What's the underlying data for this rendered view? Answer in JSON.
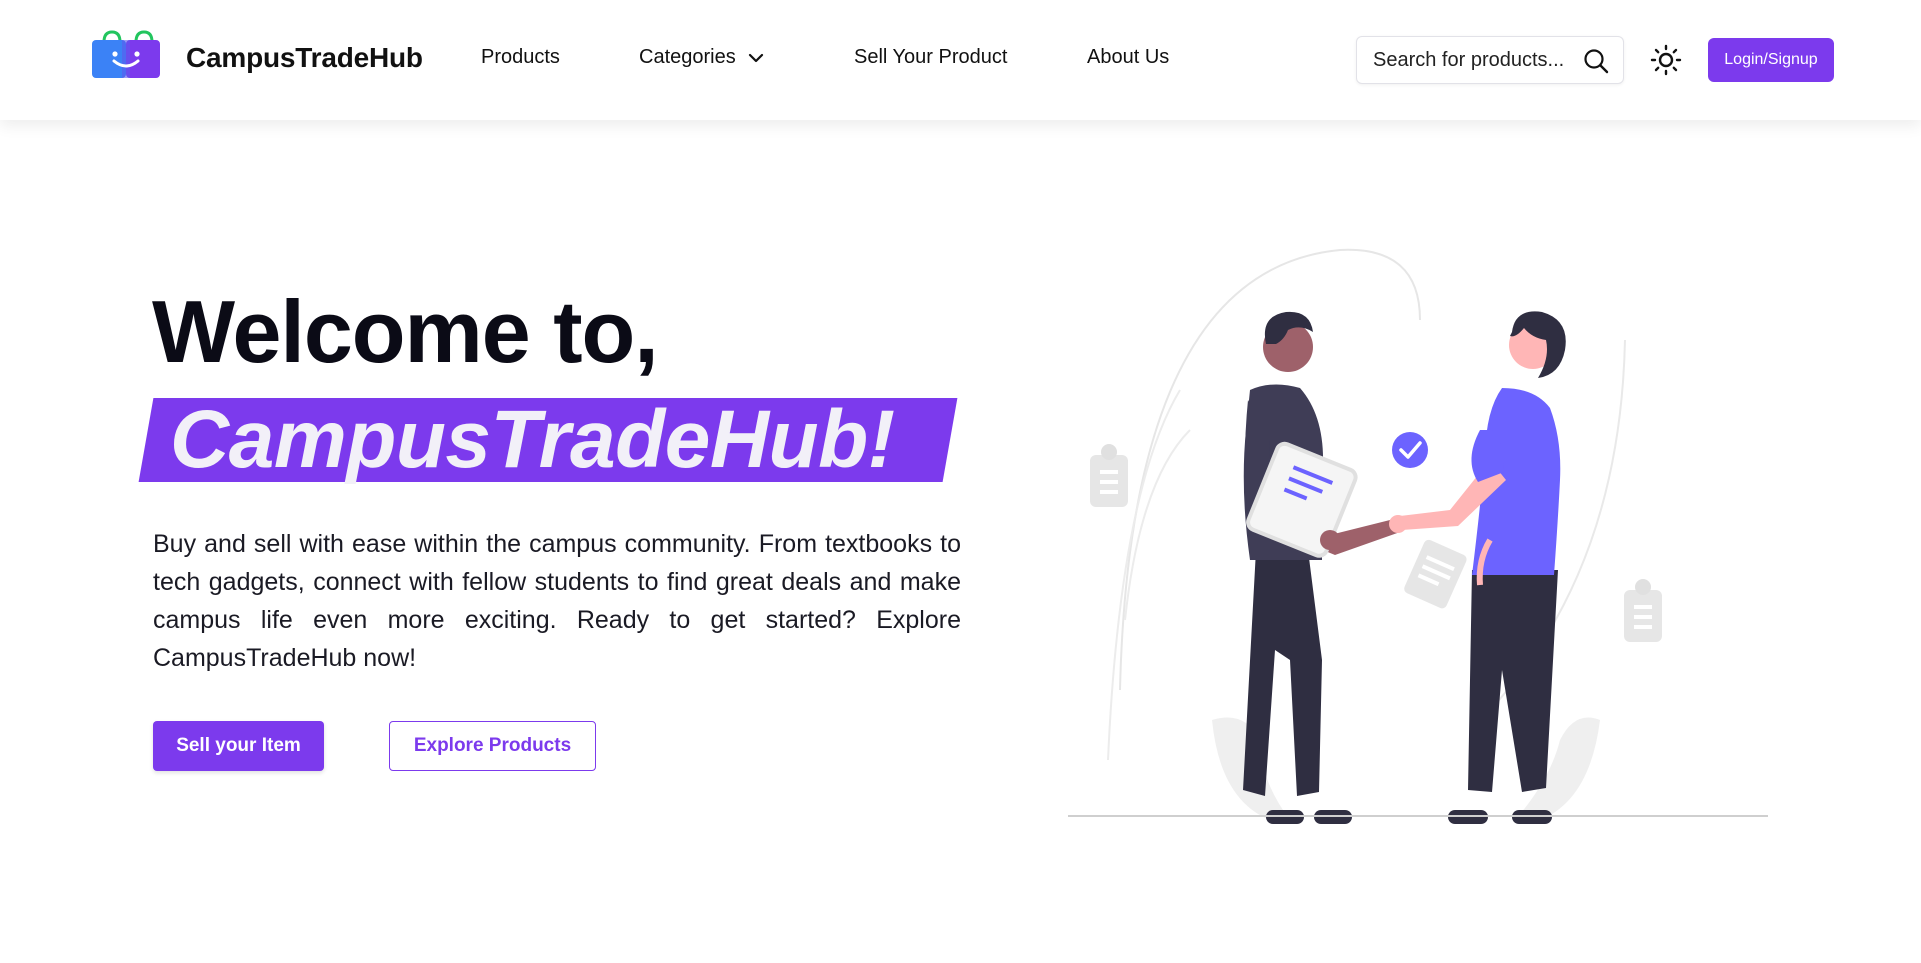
{
  "header": {
    "brand": "CampusTradeHub",
    "logo_icon": "shopping-bags-smile-icon",
    "nav": {
      "products": "Products",
      "categories": "Categories",
      "sell": "Sell Your Product",
      "about": "About Us"
    },
    "search": {
      "placeholder": "Search for products..."
    },
    "login_label": "Login/Signup"
  },
  "hero": {
    "title": "Welcome to,",
    "brand": "CampusTradeHub!",
    "description": "Buy and sell with ease within the campus community. From textbooks to tech gadgets, connect with fellow students to find great deals and make campus life even more exciting. Ready to get started? Explore CampusTradeHub now!",
    "primary_button": "Sell your Item",
    "secondary_button": "Explore Products",
    "illustration_icon": "handshake-illustration"
  },
  "colors": {
    "accent": "#7c3aed",
    "illustration_accent": "#6c63ff",
    "dark": "#2f2e41"
  }
}
